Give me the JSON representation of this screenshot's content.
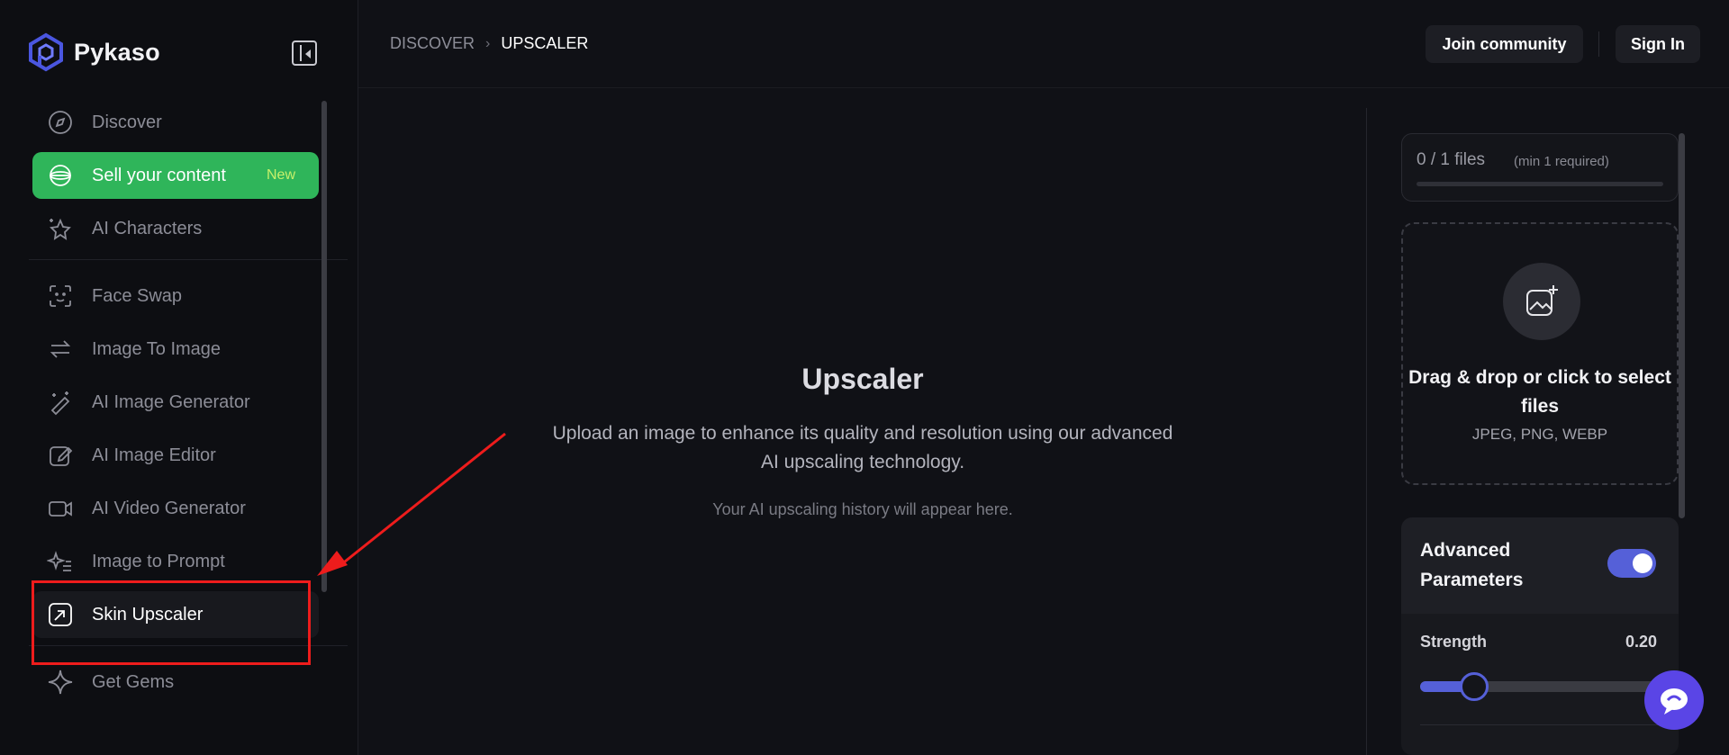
{
  "brand": {
    "name": "Pykaso"
  },
  "sidebar": {
    "items": [
      {
        "label": "Discover",
        "icon": "compass-icon"
      },
      {
        "label": "Sell your content",
        "badge": "New",
        "icon": "globe-icon"
      },
      {
        "label": "AI Characters",
        "icon": "sparkle-person-icon"
      },
      {
        "label": "Face Swap",
        "icon": "face-scan-icon"
      },
      {
        "label": "Image To Image",
        "icon": "swap-arrows-icon"
      },
      {
        "label": "AI Image Generator",
        "icon": "magic-wand-icon"
      },
      {
        "label": "AI Image Editor",
        "icon": "edit-icon"
      },
      {
        "label": "AI Video Generator",
        "icon": "video-camera-icon"
      },
      {
        "label": "Image to Prompt",
        "icon": "sparkle-text-icon"
      },
      {
        "label": "Skin Upscaler",
        "icon": "upscale-arrow-icon",
        "active": true
      },
      {
        "label": "Get Gems",
        "icon": "sparkle-star-icon"
      }
    ]
  },
  "breadcrumb": {
    "parent": "DISCOVER",
    "current": "UPSCALER"
  },
  "header": {
    "join_label": "Join community",
    "signin_label": "Sign In"
  },
  "main": {
    "title": "Upscaler",
    "description": "Upload an image to enhance its quality and resolution using our advanced AI upscaling technology.",
    "hint": "Your AI upscaling history will appear here."
  },
  "upload": {
    "files_count": "0  /  1  files",
    "files_min": "(min 1 required)",
    "progress": 0,
    "drop_title": "Drag & drop or click to select files",
    "drop_types": "JPEG, PNG, WEBP"
  },
  "advanced": {
    "title": "Advanced Parameters",
    "enabled": true,
    "strength_label": "Strength",
    "strength_value": "0.20",
    "strength_fraction": 0.2
  },
  "colors": {
    "accent": "#5560d8",
    "sell_green": "#2fb55a",
    "annotation_red": "#ee1c1c",
    "chat_purple": "#5a45e6"
  }
}
